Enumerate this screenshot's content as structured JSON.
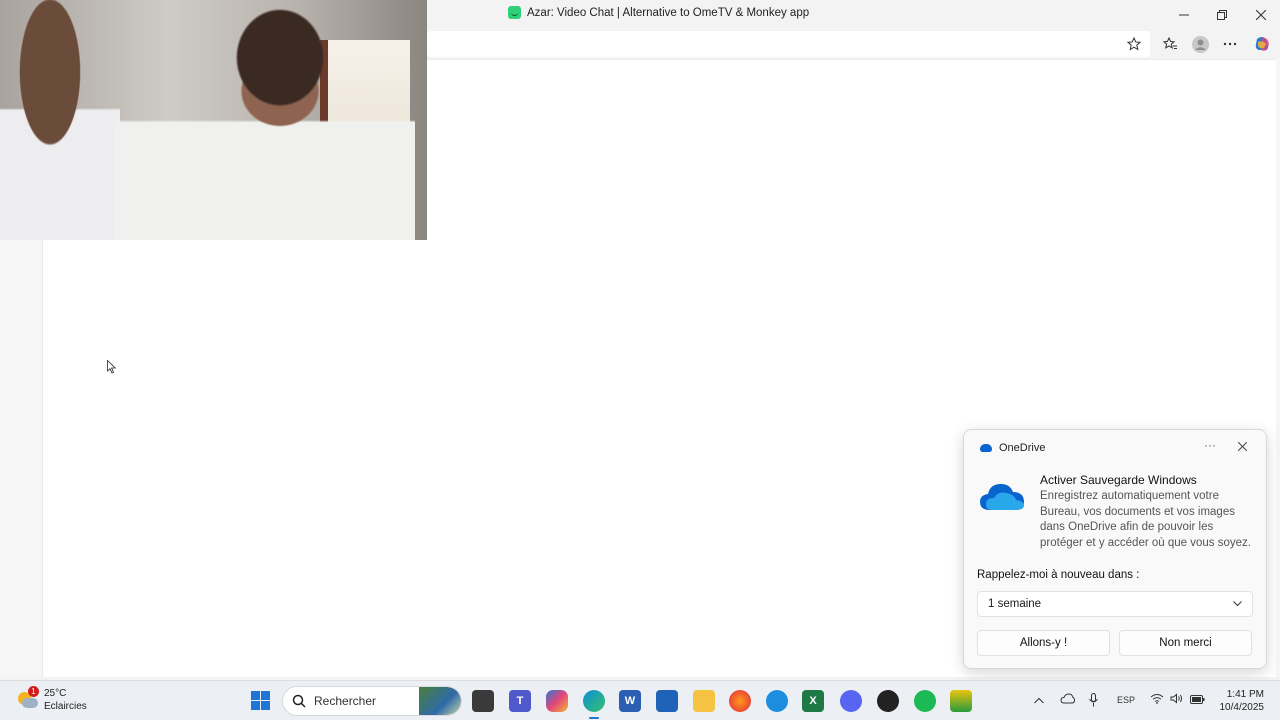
{
  "window": {
    "title": "Azar: Video Chat | Alternative to OmeTV & Monkey app"
  },
  "toast": {
    "app_name": "OneDrive",
    "title": "Activer Sauvegarde Windows",
    "body": "Enregistrez automatiquement votre Bureau, vos documents et vos images dans OneDrive afin de pouvoir les protéger et y accéder où que vous soyez.",
    "remind_label": "Rappelez-moi à nouveau dans :",
    "remind_value": "1 semaine",
    "primary_button": "Allons-y !",
    "secondary_button": "Non merci"
  },
  "taskbar": {
    "weather_temp": "25°C",
    "weather_desc": "Eclaircies",
    "weather_badge": "1",
    "search_placeholder": "Rechercher",
    "language": "ESP",
    "time": "1:41 PM",
    "date": "10/4/2025"
  },
  "colors": {
    "accent": "#1f74d6",
    "azar_green": "#2fd07a",
    "onedrive_blue": "#0a64d0"
  }
}
